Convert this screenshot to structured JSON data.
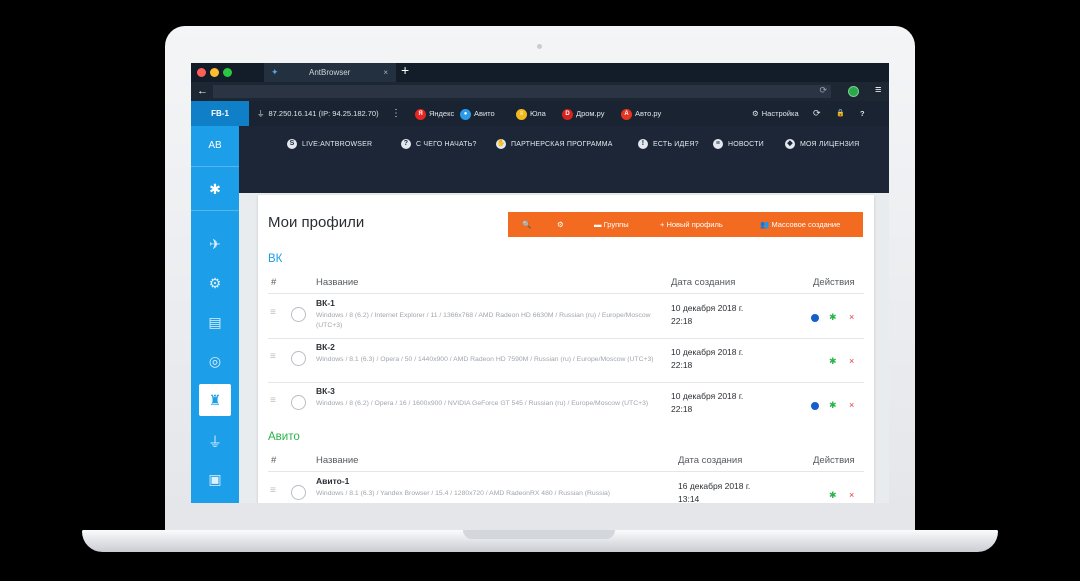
{
  "colors": {
    "accent_blue": "#1c9ee8",
    "orange": "#f26b21",
    "vk_group": "#1c9ee8",
    "avito_group": "#2bb34a",
    "mac_red": "#ff5f57",
    "mac_yellow": "#febc2e",
    "mac_green": "#28c840"
  },
  "browser": {
    "tab_title": "AntBrowser",
    "tab_close": "×",
    "new_tab": "+",
    "back": "←",
    "reload_mini": "⟳",
    "menu": "≡"
  },
  "bookbar": {
    "profile": "FB-1",
    "proxy": "87.250.16.141 (IP: 94.25.182.70)",
    "proxy_menu": "⋮",
    "bookmarks": [
      {
        "label": "Яндекс",
        "icon": "yandex-icon",
        "color": "#e52620",
        "glyph": "Я"
      },
      {
        "label": "Авито",
        "icon": "avito-icon",
        "color": "#2b9be9",
        "glyph": "●"
      },
      {
        "label": "Юла",
        "icon": "yula-icon",
        "color": "#f2b91e",
        "glyph": "≡"
      },
      {
        "label": "Дром.ру",
        "icon": "drom-icon",
        "color": "#d6231e",
        "glyph": "D"
      },
      {
        "label": "Авто.ру",
        "icon": "autoru-icon",
        "color": "#e7341f",
        "glyph": "A"
      }
    ],
    "settings": "Настройка",
    "refresh": "⟳",
    "lock": "🔒",
    "help": "?"
  },
  "sidebar": {
    "ab": "AB",
    "items": [
      "ant-icon",
      "rocket-icon",
      "gear-icon",
      "book-icon",
      "fingerprint-icon",
      "profiles-icon",
      "plug-icon",
      "robot-icon"
    ]
  },
  "topnav": {
    "items": [
      {
        "label": "LIVE:ANTBROWSER",
        "icon": "skype-icon",
        "glyph": "S"
      },
      {
        "label": "С ЧЕГО НАЧАТЬ?",
        "icon": "question-icon",
        "glyph": "?"
      },
      {
        "label": "ПАРТНЕРСКАЯ ПРОГРАММА",
        "icon": "handshake-icon",
        "glyph": "✋"
      },
      {
        "label": "ЕСТЬ ИДЕЯ?",
        "icon": "bulb-icon",
        "glyph": "!"
      },
      {
        "label": "НОВОСТИ",
        "icon": "news-icon",
        "glyph": "≡"
      },
      {
        "label": "МОЯ ЛИЦЕНЗИЯ",
        "icon": "shield-icon",
        "glyph": "◆"
      }
    ]
  },
  "main": {
    "title": "Мои профили",
    "toolbar": {
      "search": "🔍",
      "settings": "⚙",
      "groups": "Группы",
      "new_profile": "Новый профиль",
      "bulk": "Массовое создание"
    },
    "columns": {
      "num": "#",
      "name": "Название",
      "date": "Дата создания",
      "actions": "Действия"
    },
    "groups": [
      {
        "name": "ВК",
        "profiles": [
          {
            "name": "ВК-1",
            "desc": "Windows / 8 (6.2) / Internet Explorer / 11 / 1366x768 / AMD Radeon HD 6630M / Russian (ru) / Europe/Moscow (UTC+3)",
            "date": "10 декабря 2018 г. 22:18",
            "running": true
          },
          {
            "name": "ВК-2",
            "desc": "Windows / 8.1 (6.3) / Opera / 50 / 1440x900 / AMD Radeon HD 7590M / Russian (ru) / Europe/Moscow (UTC+3)",
            "date": "10 декабря 2018 г. 22:18",
            "running": false
          },
          {
            "name": "ВК-3",
            "desc": "Windows / 8 (6.2) / Opera / 16 / 1600x900 / NVIDIA GeForce GT 545 / Russian (ru) / Europe/Moscow (UTC+3)",
            "date": "10 декабря 2018 г. 22:18",
            "running": true
          }
        ]
      },
      {
        "name": "Авито",
        "profiles": [
          {
            "name": "Авито-1",
            "desc": "Windows / 8.1 (6.3) / Yandex Browser / 15.4 / 1280x720 / AMD RadeonRX 480 / Russian (Russia)",
            "date": "16 декабря 2018 г. 13:14",
            "running": false
          }
        ]
      }
    ],
    "actions": {
      "gear": "✱",
      "delete": "×"
    }
  }
}
